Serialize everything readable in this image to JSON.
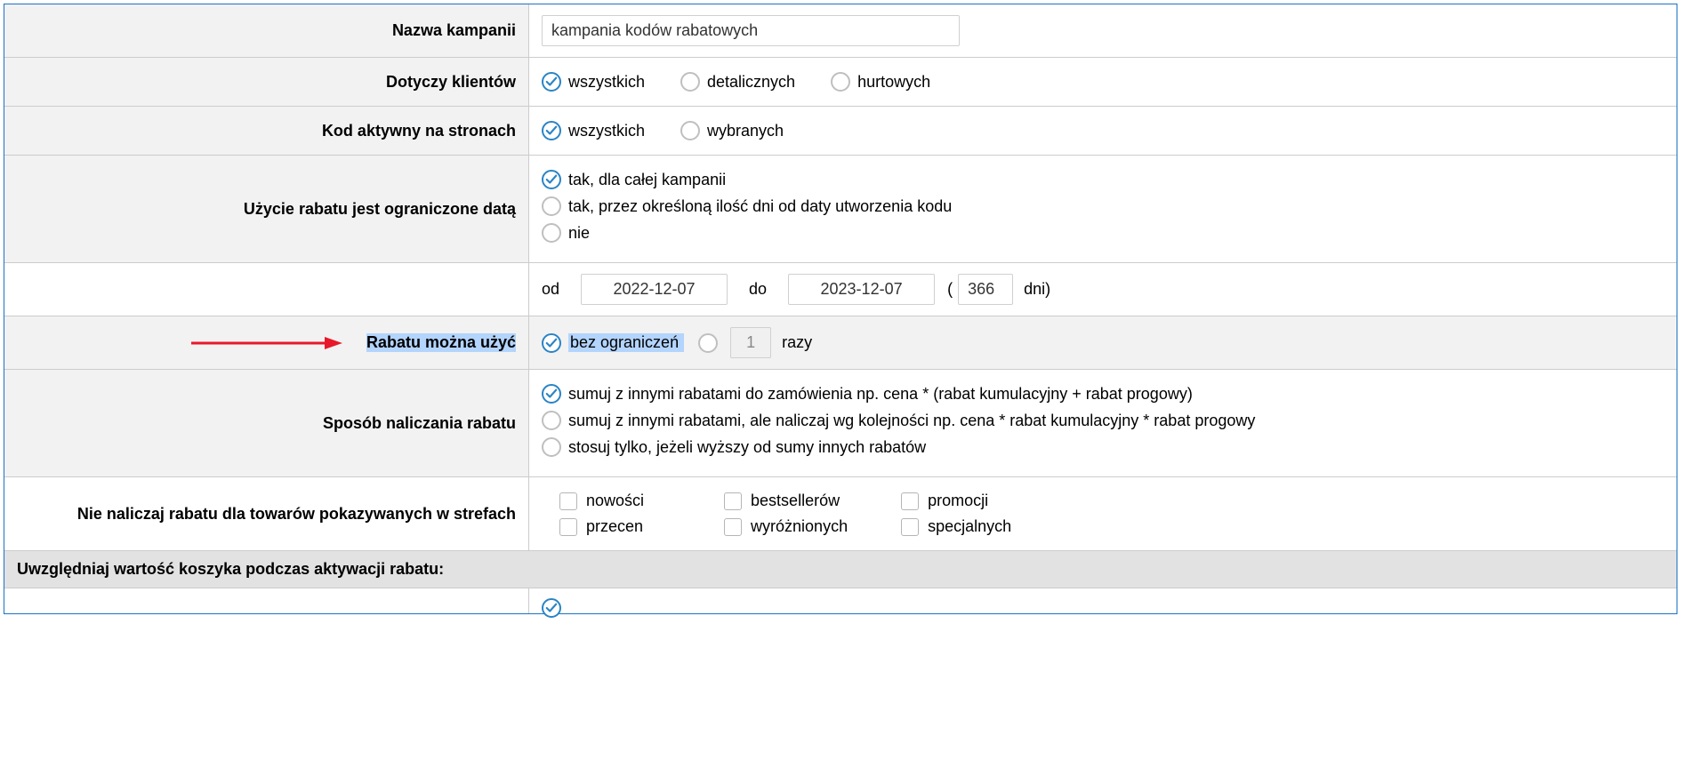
{
  "rows": {
    "campaign_name": {
      "label": "Nazwa kampanii",
      "value": "kampania kodów rabatowych"
    },
    "clients": {
      "label": "Dotyczy klientów",
      "opts": {
        "all": "wszystkich",
        "retail": "detalicznych",
        "wholesale": "hurtowych"
      }
    },
    "active_pages": {
      "label": "Kod aktywny na stronach",
      "opts": {
        "all": "wszystkich",
        "selected": "wybranych"
      }
    },
    "date_limited": {
      "label": "Użycie rabatu jest ograniczone datą",
      "opts": {
        "whole": "tak, dla całej kampanii",
        "days": "tak, przez określoną ilość dni od daty utworzenia kodu",
        "no": "nie"
      }
    },
    "date_range": {
      "from_label": "od",
      "from_value": "2022-12-07",
      "to_label": "do",
      "to_value": "2023-12-07",
      "days_value": "366",
      "days_label": "dni)"
    },
    "usage": {
      "label": "Rabatu można użyć",
      "opts": {
        "unlimited": "bez ograniczeń",
        "times_value": "1",
        "times_label": "razy"
      }
    },
    "calc": {
      "label": "Sposób naliczania rabatu",
      "opts": {
        "sum": "sumuj z innymi rabatami do zamówienia np. cena * (rabat kumulacyjny + rabat progowy)",
        "seq": "sumuj z innymi rabatami, ale naliczaj wg kolejności np. cena * rabat kumulacyjny * rabat progowy",
        "higher": "stosuj tylko, jeżeli wyższy od sumy innych rabatów"
      }
    },
    "zones": {
      "label": "Nie naliczaj rabatu dla towarów pokazywanych w strefach",
      "opts": {
        "new": "nowości",
        "sale": "przecen",
        "best": "bestsellerów",
        "featured": "wyróżnionych",
        "promo": "promocji",
        "special": "specjalnych"
      }
    },
    "cart_header": "Uwzględniaj wartość koszyka podczas aktywacji rabatu:"
  }
}
